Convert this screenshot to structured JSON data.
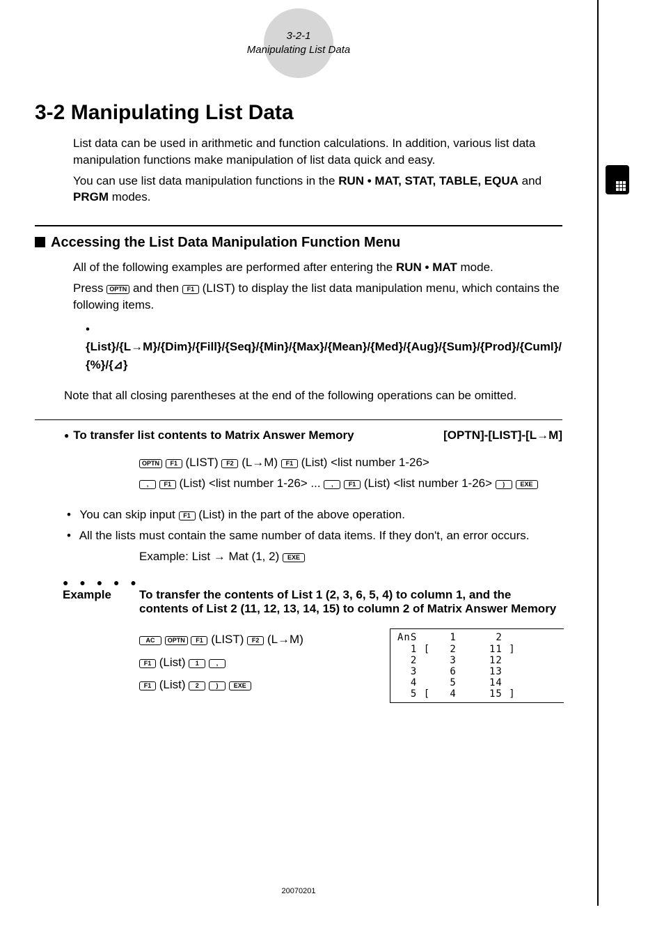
{
  "header": {
    "num": "3-2-1",
    "title": "Manipulating List Data"
  },
  "chapter": {
    "num": "3-2",
    "title": "Manipulating List Data"
  },
  "intro": {
    "p1": "List data can be used in arithmetic and function calculations. In addition, various list data manipulation functions make manipulation of list data quick and easy.",
    "p2a": "You can use list data manipulation functions in the ",
    "modes": "RUN • MAT, STAT, TABLE, EQUA",
    "p2b": " and ",
    "modes2": "PRGM",
    "p2c": " modes."
  },
  "section1": {
    "title": "Accessing the List Data Manipulation Function Menu",
    "p1a": "All of the following examples are performed after entering the ",
    "p1mode": "RUN • MAT",
    "p1b": " mode.",
    "p2a": "Press ",
    "p2b": " and then ",
    "p2c": "(LIST) to display the list data manipulation menu, which contains the following items.",
    "menu": "{List}/{L→M}/{Dim}/{Fill}/{Seq}/{Min}/{Max}/{Mean}/{Med}/{Aug}/{Sum}/{Prod}/{Cuml}/ {%}/{⊿}",
    "note": "Note that all closing parentheses at the end of the following operations can be omitted."
  },
  "sub1": {
    "title": "To transfer list contents to Matrix Answer Memory",
    "path": "[OPTN]-[LIST]-[L→M]",
    "proc1a": "(LIST)",
    "proc1b": "(L→M)",
    "proc1c": "(List) <list number 1-26>",
    "proc2a": "(List) <list number 1-26> ... ",
    "proc2b": "(List) <list number 1-26> ",
    "bul1a": "You can skip input ",
    "bul1b": "(List) in the part of the above operation.",
    "bul2": "All the lists must contain the same number of data items. If they don't, an error occurs.",
    "ex_inline": "Example: List → Mat (1, 2)"
  },
  "example": {
    "label": "Example",
    "text": "To transfer the contents of List 1 (2, 3, 6, 5, 4) to column 1, and the contents of List 2 (11, 12, 13, 14, 15) to column 2 of Matrix Answer Memory",
    "in1a": "(LIST)",
    "in1b": "(L→M)",
    "in2": "(List)",
    "in3": "(List)"
  },
  "screen": {
    "line1": "AnS     1      2",
    "line2": "  1 [   2     11 ]",
    "line3": "  2     3     12",
    "line4": "  3     6     13",
    "line5": "  4     5     14",
    "line6": "  5 [   4     15 ]"
  },
  "keys": {
    "optn": "OPTN",
    "f1": "F1",
    "f2": "F2",
    "comma": ",",
    "close": ")",
    "exe": "EXE",
    "ac": "AC",
    "k1": "1",
    "k2": "2"
  },
  "footer": "20070201"
}
